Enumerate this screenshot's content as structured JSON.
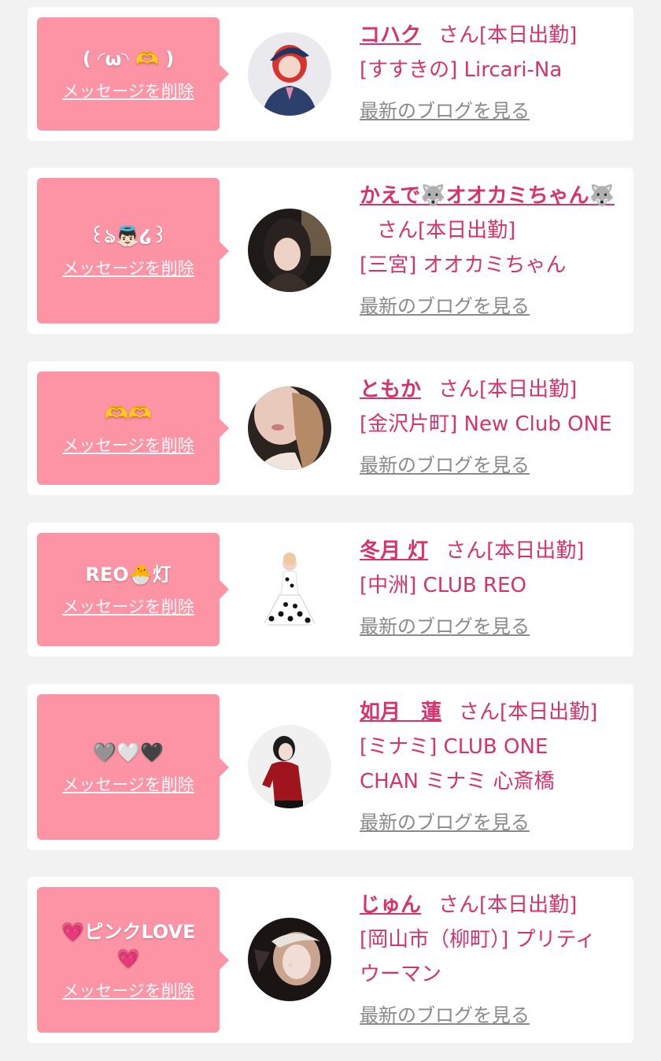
{
  "colors": {
    "accent": "#d6336c",
    "bubble": "#fc94a6",
    "background": "#f2f2f2",
    "muted": "#8a8a8a"
  },
  "cards": [
    {
      "message_lines": [
        "( ◜ω◝ 🫶 )"
      ],
      "delete_label": "メッセージを削除",
      "name": "コハク",
      "honorific": "さん",
      "status": "[本日出勤]",
      "shop_lines": [
        "[すすきの] Lircari-Na"
      ],
      "blog_label": "最新のブログを見る"
    },
    {
      "message_lines": [
        "꒰ঌ👼🏻໒꒱"
      ],
      "delete_label": "メッセージを削除",
      "name": "かえで🐺オオカミちゃん🐺",
      "honorific": "さん",
      "status": "[本日出勤]",
      "shop_lines": [
        "[三宮] オオカミちゃん"
      ],
      "blog_label": "最新のブログを見る"
    },
    {
      "message_lines": [
        "🫶🫶"
      ],
      "delete_label": "メッセージを削除",
      "name": "ともか",
      "honorific": "さん",
      "status": "[本日出勤]",
      "shop_lines": [
        "[金沢片町] New Club ONE"
      ],
      "blog_label": "最新のブログを見る"
    },
    {
      "message_lines": [
        "REO🐣灯"
      ],
      "delete_label": "メッセージを削除",
      "name": "冬月 灯",
      "honorific": "さん",
      "status": "[本日出勤]",
      "shop_lines": [
        "[中洲] CLUB REO"
      ],
      "blog_label": "最新のブログを見る"
    },
    {
      "message_lines": [
        "🩶🤍🖤"
      ],
      "delete_label": "メッセージを削除",
      "name": "如月　蓮",
      "honorific": "さん",
      "status": "[本日出勤]",
      "shop_lines": [
        "[ミナミ] CLUB ONE",
        "CHAN ミナミ 心斎橋"
      ],
      "blog_label": "最新のブログを見る"
    },
    {
      "message_lines": [
        "💗ピンクLOVE",
        "💗"
      ],
      "delete_label": "メッセージを削除",
      "name": "じゅん",
      "honorific": "さん",
      "status": "[本日出勤]",
      "shop_lines": [
        "[岡山市（柳町）] プリティ",
        "ウーマン"
      ],
      "blog_label": "最新のブログを見る"
    }
  ]
}
